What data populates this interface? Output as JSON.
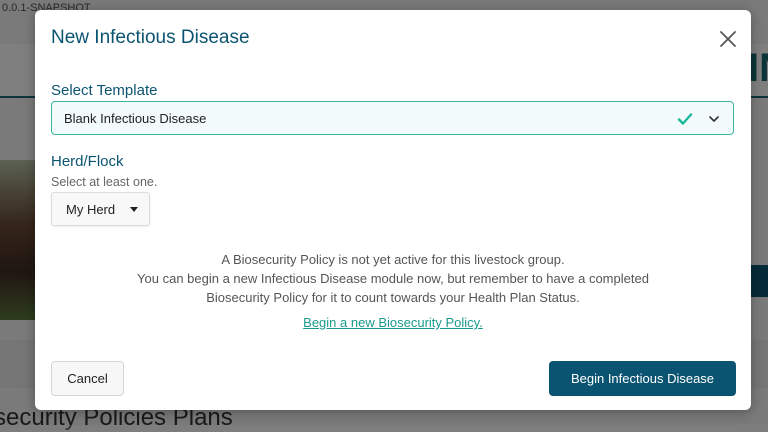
{
  "background": {
    "version": "0.0.1-SNAPSHOT",
    "brand_fragment": "IN",
    "section_heading": "security Policies Plans"
  },
  "modal": {
    "title": "New Infectious Disease",
    "close_icon": "close-icon",
    "template": {
      "label": "Select Template",
      "selected": "Blank Infectious Disease",
      "valid_icon": "check-icon",
      "accent_color": "#1ab89a"
    },
    "herd": {
      "label": "Herd/Flock",
      "hint": "Select at least one.",
      "dropdown_value": "My Herd"
    },
    "notice": {
      "line1": "A Biosecurity Policy is not yet active for this livestock group.",
      "line2": "You can begin a new Infectious Disease module now, but remember to have a completed",
      "line3": "Biosecurity Policy for it to count towards your Health Plan Status.",
      "link": "Begin a new Biosecurity Policy."
    },
    "buttons": {
      "cancel": "Cancel",
      "primary": "Begin Infectious Disease"
    },
    "colors": {
      "primary": "#0b5471",
      "link": "#1a9a8c"
    }
  }
}
